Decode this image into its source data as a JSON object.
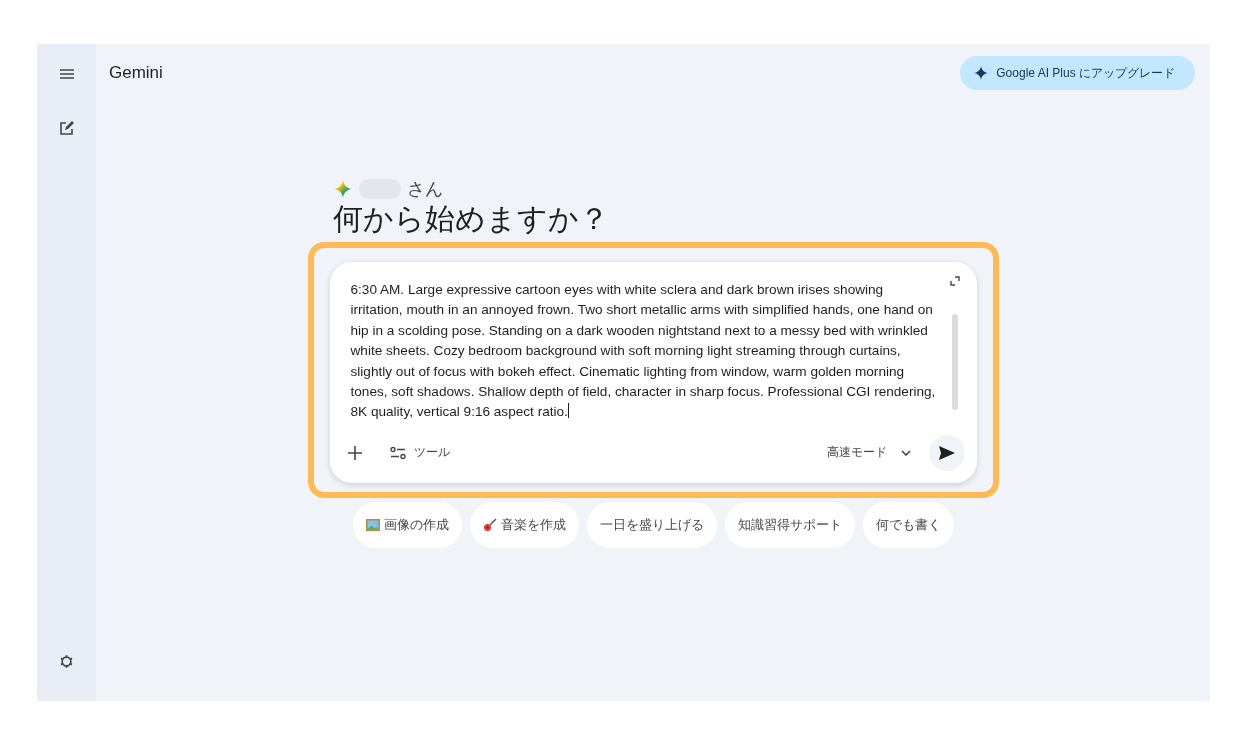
{
  "app": {
    "title": "Gemini"
  },
  "upgrade_button": {
    "label": "Google AI Plus にアップグレード"
  },
  "greeting": {
    "name_suffix": "さん",
    "headline": "何から始めますか？"
  },
  "prompt": {
    "value": "6:30 AM. Large expressive cartoon eyes with white sclera and dark brown irises showing irritation, mouth in an annoyed frown. Two short metallic arms with simplified hands, one hand on hip in a scolding pose. Standing on a dark wooden nightstand next to a messy bed with wrinkled white sheets. Cozy bedroom background with soft morning light streaming through curtains, slightly out of focus with bokeh effect. Cinematic lighting from window, warm golden morning tones, soft shadows. Shallow depth of field, character in sharp focus. Professional CGI rendering, 8K quality, vertical 9:16 aspect ratio.",
    "tools_label": "ツール",
    "mode_label": "高速モード",
    "highlighted": true
  },
  "suggestions": [
    {
      "kind": "image",
      "label": "画像の作成"
    },
    {
      "kind": "music",
      "label": "音楽を作成"
    },
    {
      "kind": "plain",
      "label": "一日を盛り上げる"
    },
    {
      "kind": "plain",
      "label": "知識習得サポート"
    },
    {
      "kind": "plain",
      "label": "何でも書く"
    }
  ]
}
